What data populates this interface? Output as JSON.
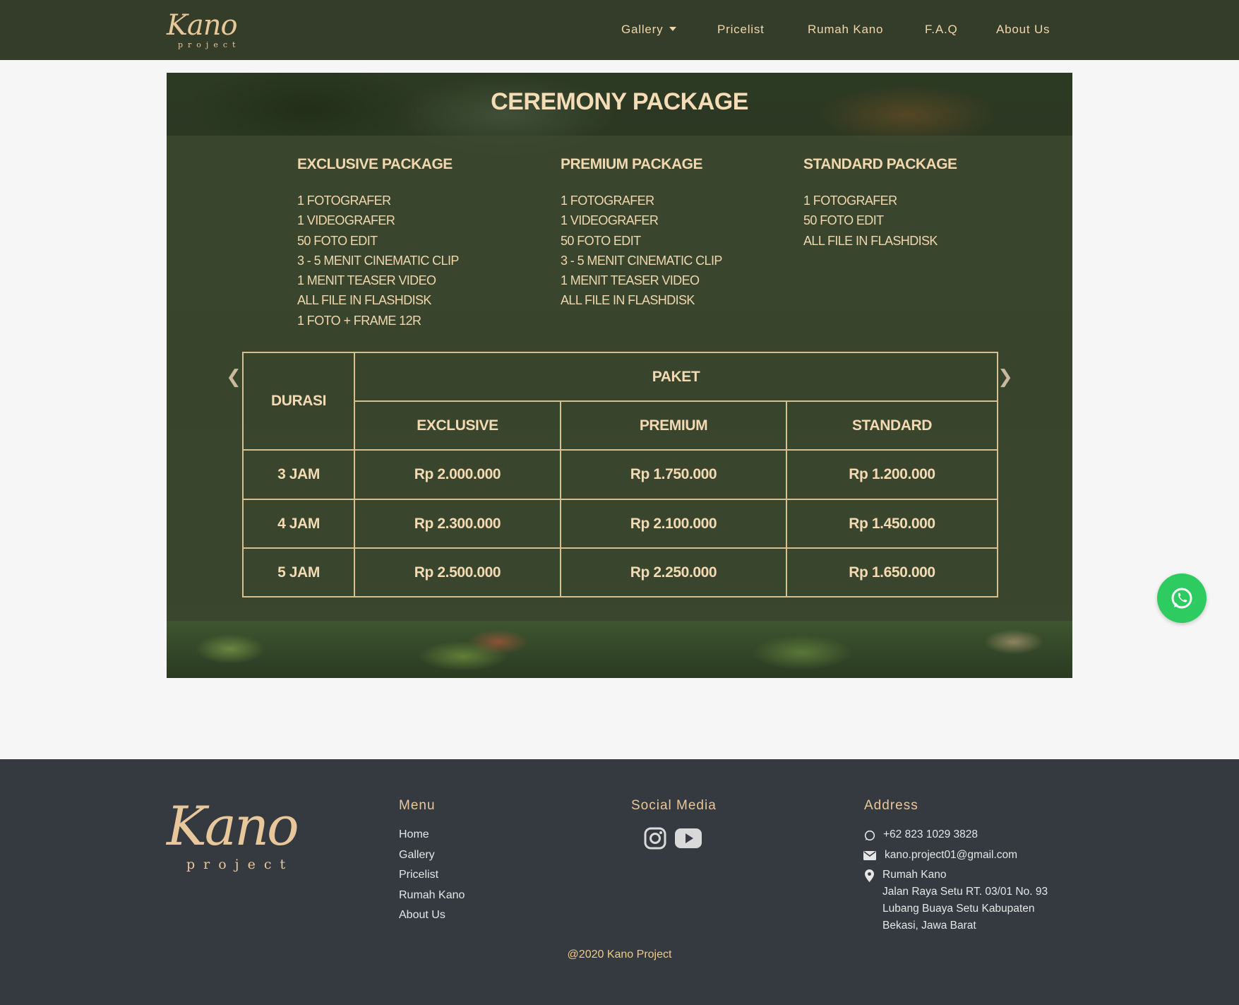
{
  "navbar": {
    "brand_script": "Kano",
    "brand_sub": "project",
    "items": [
      "Gallery",
      "Pricelist",
      "Rumah Kano",
      "F.A.Q",
      "About Us"
    ]
  },
  "hero": {
    "title": "CEREMONY PACKAGE",
    "packages": [
      {
        "name": "EXCLUSIVE PACKAGE",
        "items": [
          "1 FOTOGRAFER",
          "1 VIDEOGRAFER",
          "50 FOTO EDIT",
          "3 - 5 MENIT CINEMATIC CLIP",
          "1 MENIT TEASER VIDEO",
          "ALL FILE IN FLASHDISK",
          "1 FOTO + FRAME 12R"
        ]
      },
      {
        "name": "PREMIUM PACKAGE",
        "items": [
          "1 FOTOGRAFER",
          "1 VIDEOGRAFER",
          "50 FOTO EDIT",
          "3 - 5 MENIT CINEMATIC CLIP",
          "1 MENIT TEASER VIDEO",
          "ALL FILE IN FLASHDISK"
        ]
      },
      {
        "name": "STANDARD PACKAGE",
        "items": [
          "1 FOTOGRAFER",
          "50 FOTO EDIT",
          "ALL FILE IN FLASHDISK"
        ]
      }
    ],
    "table": {
      "durasi_header": "DURASI",
      "paket_header": "PAKET",
      "columns": [
        "EXCLUSIVE",
        "PREMIUM",
        "STANDARD"
      ],
      "rows": [
        {
          "durasi": "3 JAM",
          "prices": [
            "Rp 2.000.000",
            "Rp 1.750.000",
            "Rp 1.200.000"
          ]
        },
        {
          "durasi": "4 JAM",
          "prices": [
            "Rp 2.300.000",
            "Rp 2.100.000",
            "Rp 1.450.000"
          ]
        },
        {
          "durasi": "5 JAM",
          "prices": [
            "Rp 2.500.000",
            "Rp 2.250.000",
            "Rp 1.650.000"
          ]
        }
      ]
    }
  },
  "footer": {
    "brand_script": "Kano",
    "brand_sub": "project",
    "menu_title": "Menu",
    "menu": [
      "Home",
      "Gallery",
      "Pricelist",
      "Rumah Kano",
      "About Us"
    ],
    "social_title": "Social Media",
    "social_icons": [
      "instagram-icon",
      "youtube-icon"
    ],
    "address_title": "Address",
    "phone": "+62 823 1029 3828",
    "email": "kano.project01@gmail.com",
    "address": [
      "Rumah Kano",
      "Jalan Raya Setu RT. 03/01 No. 93",
      "Lubang Buaya Setu Kabupaten",
      "Bekasi, Jawa Barat"
    ],
    "copyright": "@2020 Kano Project"
  },
  "colors": {
    "navbar_bg": "#343d2a",
    "accent": "#e8c79a",
    "footer_bg": "#343a40",
    "whatsapp": "#2ecc60"
  }
}
